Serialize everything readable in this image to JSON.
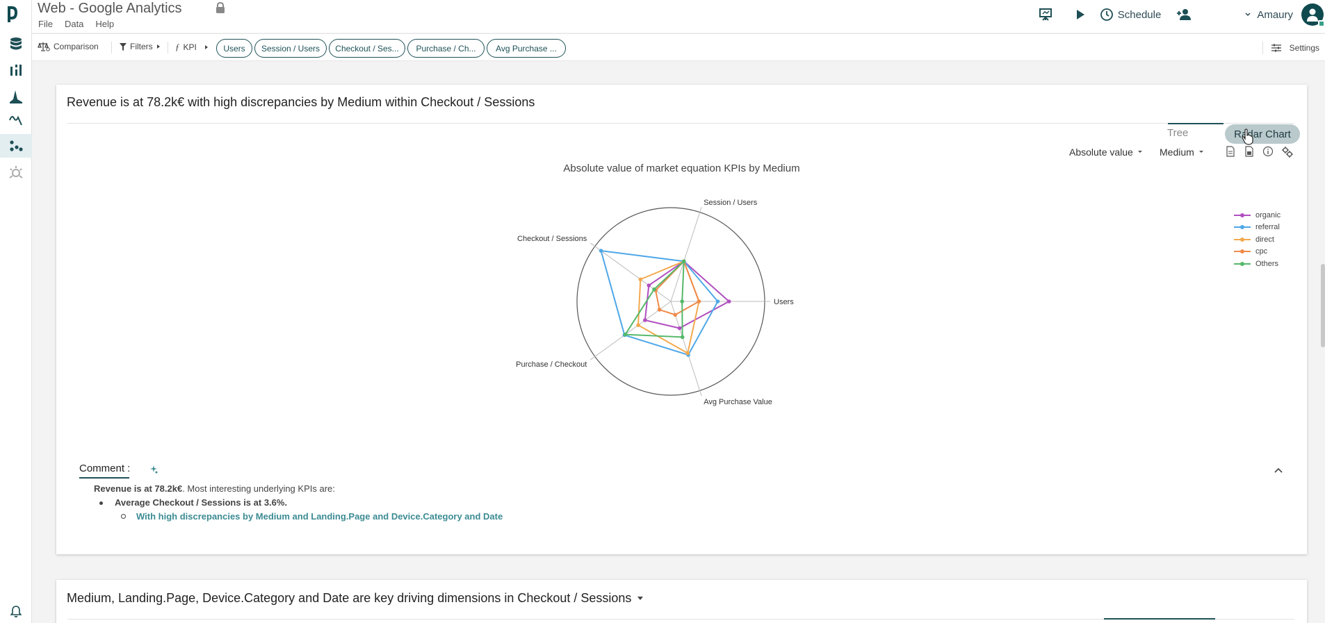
{
  "app": {
    "title": "Web - Google Analytics",
    "menu": [
      "File",
      "Data",
      "Help"
    ]
  },
  "header": {
    "schedule_label": "Schedule",
    "user_name": "Amaury"
  },
  "toolbar": {
    "comparison_label": "Comparison",
    "filters_label": "Filters",
    "kpi_label": "KPI",
    "kpi_chips": [
      "Users",
      "Session / Users",
      "Checkout / Ses...",
      "Purchase / Ch...",
      "Avg Purchase ..."
    ],
    "settings_label": "Settings"
  },
  "card": {
    "title": "Revenue is at 78.2k€ with high discrepancies by Medium within Checkout / Sessions",
    "tabs": [
      "Tree",
      "Radar Chart"
    ],
    "active_tab": "Radar Chart",
    "value_select": "Absolute value",
    "dimension_select": "Medium",
    "comment_label": "Comment :",
    "comment_lead_bold": "Revenue is at 78.2k€",
    "comment_lead_rest": ". Most interesting underlying KPIs are:",
    "comment_bullet": "Average Checkout / Sessions is at 3.6%.",
    "comment_subbullet": "With high discrepancies by Medium and Landing.Page and Device.Category and Date"
  },
  "chart_data": {
    "type": "radar",
    "title": "Absolute value of market equation KPIs by Medium",
    "axes": [
      "Users",
      "Session / Users",
      "Checkout / Sessions",
      "Purchase / Checkout",
      "Avg Purchase Value"
    ],
    "range": [
      0,
      1
    ],
    "series": [
      {
        "name": "organic",
        "color": "#b04fc0",
        "values": [
          0.62,
          0.45,
          0.29,
          0.34,
          0.3
        ]
      },
      {
        "name": "referral",
        "color": "#4ea7e8",
        "values": [
          0.5,
          0.45,
          0.92,
          0.61,
          0.6
        ]
      },
      {
        "name": "direct",
        "color": "#f2a94d",
        "values": [
          0.3,
          0.45,
          0.4,
          0.43,
          0.58
        ]
      },
      {
        "name": "cpc",
        "color": "#ef8b4a",
        "values": [
          0.3,
          0.45,
          0.2,
          0.15,
          0.15
        ]
      },
      {
        "name": "Others",
        "color": "#55b86a",
        "values": [
          0.12,
          0.45,
          0.22,
          0.6,
          0.4
        ]
      }
    ]
  },
  "card2": {
    "title": "Medium, Landing.Page, Device.Category and Date are key driving dimensions in Checkout / Sessions"
  }
}
